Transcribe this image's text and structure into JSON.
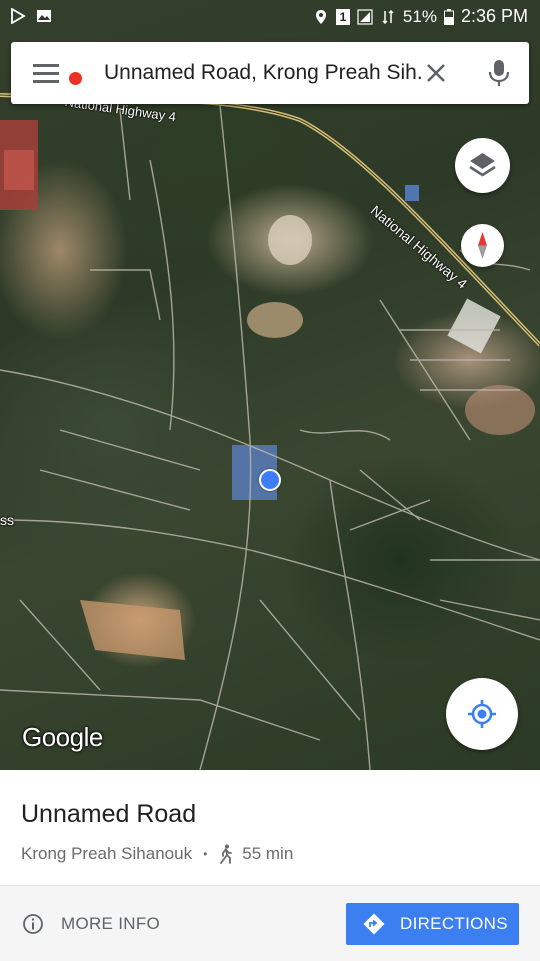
{
  "status_bar": {
    "battery": "51%",
    "time": "2:36 PM",
    "sim_badge": "1"
  },
  "search": {
    "query": "Unnamed Road, Krong Preah Sih..."
  },
  "map": {
    "road_labels": [
      "National Highway 4",
      "National Highway 4",
      "ss"
    ],
    "logo": "Google"
  },
  "place": {
    "title": "Unnamed Road",
    "locality": "Krong Preah Sihanouk",
    "separator": "•",
    "walk_time": "55 min"
  },
  "actions": {
    "more_info": "MORE INFO",
    "directions": "DIRECTIONS"
  },
  "colors": {
    "accent": "#3b7ff0",
    "notification": "#ea3323",
    "location_dot": "#3d7ef6"
  }
}
